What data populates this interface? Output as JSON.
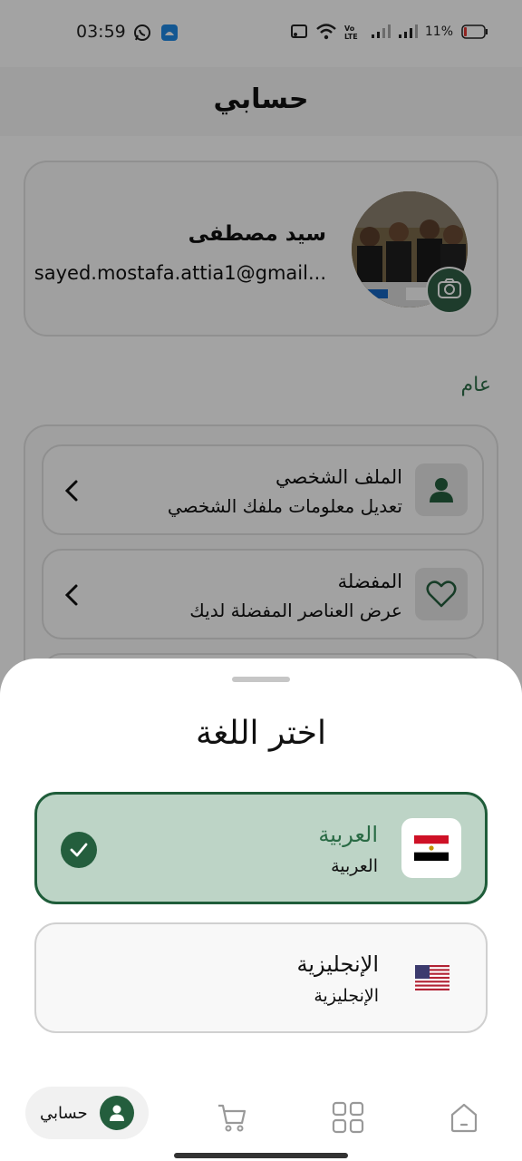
{
  "status_bar": {
    "time": "03:59",
    "battery": "11%",
    "icons": [
      "whatsapp-icon",
      "android-icon",
      "cast-icon",
      "wifi-icon",
      "volte-icon",
      "signal-icon",
      "battery-icon"
    ]
  },
  "header": {
    "title": "حسابي"
  },
  "profile": {
    "name": "سيد مصطفى",
    "email": "sayed.mostafa.attia1@gmail..."
  },
  "section": {
    "title": "عام"
  },
  "menu": {
    "items": [
      {
        "title": "الملف الشخصي",
        "subtitle": "تعديل معلومات ملفك الشخصي",
        "icon": "person-icon"
      },
      {
        "title": "المفضلة",
        "subtitle": "عرض العناصر المفضلة لديك",
        "icon": "heart-icon"
      }
    ]
  },
  "language_sheet": {
    "title": "اختر اللغة",
    "options": [
      {
        "name": "العربية",
        "native": "العربية",
        "flag": "egypt-flag-icon",
        "selected": true
      },
      {
        "name": "الإنجليزية",
        "native": "الإنجليزية",
        "flag": "usa-flag-icon",
        "selected": false
      }
    ]
  },
  "bottom_nav": {
    "account_label": "حسابي",
    "items": [
      "account-icon",
      "cart-icon",
      "categories-icon",
      "home-icon"
    ]
  },
  "colors": {
    "primary": "#245e3d",
    "selected_bg": "#bdd4c6",
    "section_accent": "#2f6f4a"
  }
}
